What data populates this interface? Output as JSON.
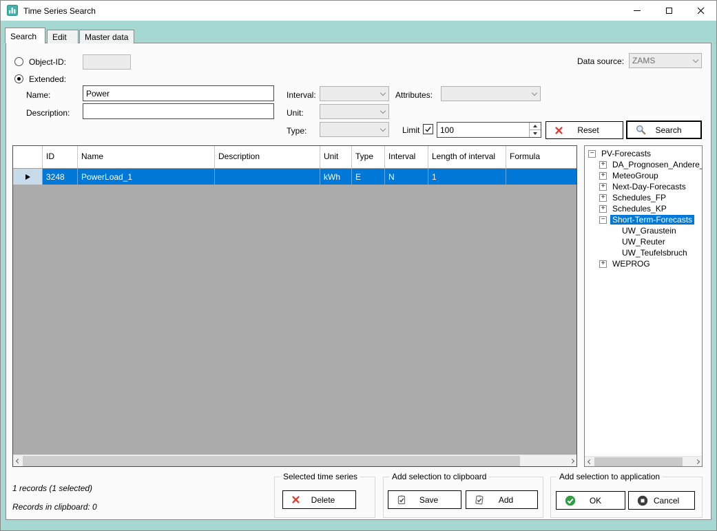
{
  "window": {
    "title": "Time Series Search"
  },
  "tabs": [
    {
      "label": "Search"
    },
    {
      "label": "Edit"
    },
    {
      "label": "Master data"
    }
  ],
  "search_form": {
    "object_id": {
      "label": "Object-ID:",
      "value": ""
    },
    "extended_label": "Extended:",
    "data_source": {
      "label": "Data source:",
      "value": "ZAMS"
    },
    "name": {
      "label": "Name:",
      "value": "Power"
    },
    "description": {
      "label": "Description:",
      "value": ""
    },
    "interval": {
      "label": "Interval:",
      "value": ""
    },
    "unit": {
      "label": "Unit:",
      "value": ""
    },
    "type": {
      "label": "Type:",
      "value": ""
    },
    "attributes": {
      "label": "Attributes:",
      "value": ""
    },
    "limit": {
      "label": "Limit",
      "checked": true,
      "value": "100"
    },
    "reset_button": "Reset",
    "search_button": "Search"
  },
  "results_grid": {
    "columns": [
      "ID",
      "Name",
      "Description",
      "Unit",
      "Type",
      "Interval",
      "Length of interval",
      "Formula"
    ],
    "rows": [
      {
        "id": "3248",
        "name": "PowerLoad_1",
        "description": "",
        "unit": "kWh",
        "type": "E",
        "interval": "N",
        "length_of_interval": "1",
        "formula": ""
      }
    ]
  },
  "tree": {
    "items": [
      {
        "label": "PV-Forecasts",
        "level": 0,
        "state": "expanded"
      },
      {
        "label": "DA_Prognosen_Andere_",
        "level": 1,
        "state": "collapsed"
      },
      {
        "label": "MeteoGroup",
        "level": 1,
        "state": "collapsed"
      },
      {
        "label": "Next-Day-Forecasts",
        "level": 1,
        "state": "collapsed"
      },
      {
        "label": "Schedules_FP",
        "level": 1,
        "state": "collapsed"
      },
      {
        "label": "Schedules_KP",
        "level": 1,
        "state": "collapsed"
      },
      {
        "label": "Short-Term-Forecasts",
        "level": 1,
        "state": "expanded",
        "selected": true
      },
      {
        "label": "UW_Graustein",
        "level": 2,
        "state": "leaf"
      },
      {
        "label": "UW_Reuter",
        "level": 2,
        "state": "leaf"
      },
      {
        "label": "UW_Teufelsbruch",
        "level": 2,
        "state": "leaf"
      },
      {
        "label": "WEPROG",
        "level": 1,
        "state": "collapsed"
      }
    ]
  },
  "status": {
    "records": "1 records (1 selected)",
    "clipboard": "Records in clipboard: 0"
  },
  "actions": {
    "selected_time_series": {
      "label": "Selected time series",
      "delete_button": "Delete"
    },
    "clipboard_group": {
      "label": "Add selection to clipboard",
      "save_button": "Save",
      "add_button": "Add"
    },
    "application_group": {
      "label": "Add selection to application",
      "ok_button": "OK",
      "cancel_button": "Cancel"
    }
  },
  "colors": {
    "frame_teal": "#a6d8d3",
    "selection_blue": "#0078d7",
    "grid_empty_gray": "#ababab",
    "delete_red": "#e23d2e",
    "ok_green": "#2f9e44"
  }
}
